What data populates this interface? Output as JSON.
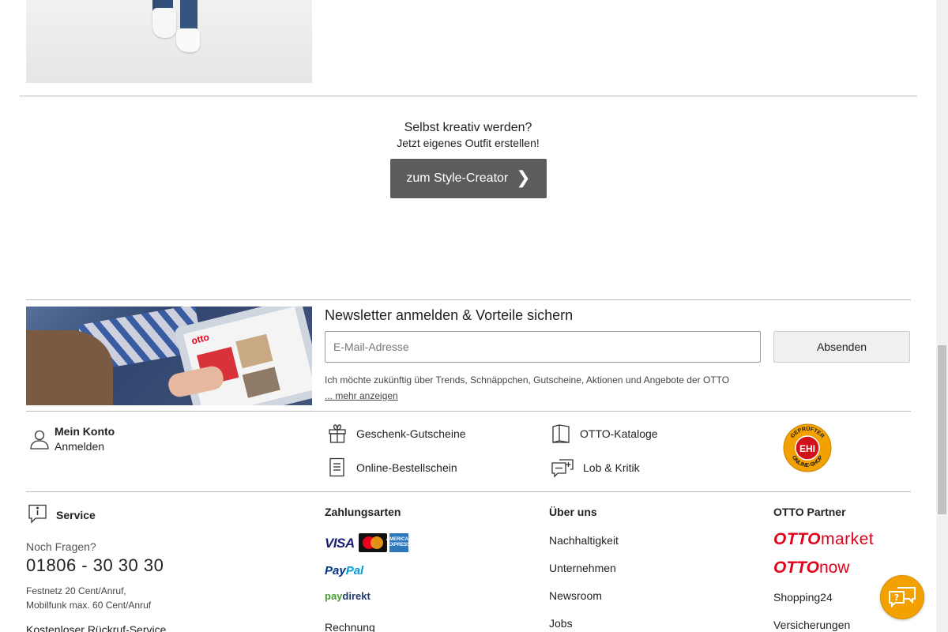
{
  "style_creator": {
    "title": "Selbst kreativ werden?",
    "subtitle": "Jetzt eigenes Outfit erstellen!",
    "button_label": "zum Style-Creator"
  },
  "newsletter": {
    "title": "Newsletter anmelden & Vorteile sichern",
    "email_placeholder": "E-Mail-Adresse",
    "email_value": "",
    "submit_label": "Absenden",
    "consent_text": "Ich möchte zukünftig über Trends, Schnäppchen, Gutscheine, Aktionen und Angebote der OTTO",
    "more_link": "... mehr anzeigen",
    "image_brand": "otto"
  },
  "quick_links": {
    "account_title": "Mein Konto",
    "account_login": "Anmelden",
    "gift_vouchers": "Geschenk-Gutscheine",
    "order_form": "Online-Bestellschein",
    "catalogs": "OTTO-Kataloge",
    "feedback": "Lob & Kritik",
    "ehi_seal_text": "GEPRÜFTER ONLINE-SHOP",
    "ehi_center": "EHI"
  },
  "service": {
    "title": "Service",
    "question": "Noch Fragen?",
    "phone": "01806 - 30 30 30",
    "note_line1": "Festnetz 20 Cent/Anruf,",
    "note_line2": "Mobilfunk max. 60 Cent/Anruf",
    "callback": "Kostenloser Rückruf-Service"
  },
  "payment": {
    "title": "Zahlungsarten",
    "visa": "VISA",
    "mastercard": "mastercard",
    "amex": "AMERICAN EXPRESS",
    "paypal_a": "Pay",
    "paypal_b": "Pal",
    "paydirekt_a": "pay",
    "paydirekt_b": "direkt",
    "invoice": "Rechnung"
  },
  "about": {
    "title": "Über uns",
    "links": [
      "Nachhaltigkeit",
      "Unternehmen",
      "Newsroom",
      "Jobs"
    ]
  },
  "partner": {
    "title": "OTTO Partner",
    "otto": "OTTO",
    "market": "market",
    "now": "now",
    "links": [
      "Shopping24",
      "Versicherungen"
    ]
  },
  "colors": {
    "otto_red": "#e2001a",
    "chat_orange": "#f2a100",
    "button_dark": "#5c5c5c"
  }
}
